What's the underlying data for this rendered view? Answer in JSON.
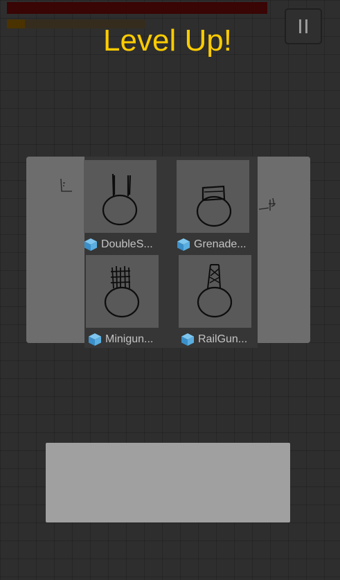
{
  "hud": {
    "health_color": "#3a0505",
    "xp_color": "#4a3300",
    "xp_progress": 0.13,
    "pause_icon": "pause-icon"
  },
  "title": "Level Up!",
  "title_color": "#ffcc00",
  "cards": [
    {
      "label": "DoubleS...",
      "icon": "asset-cube-icon",
      "weapon": "double-barrel"
    },
    {
      "label": "Grenade...",
      "icon": "asset-cube-icon",
      "weapon": "grenade"
    },
    {
      "label": "Minigun...",
      "icon": "asset-cube-icon",
      "weapon": "minigun"
    },
    {
      "label": "RailGun...",
      "icon": "asset-cube-icon",
      "weapon": "railgun"
    }
  ]
}
